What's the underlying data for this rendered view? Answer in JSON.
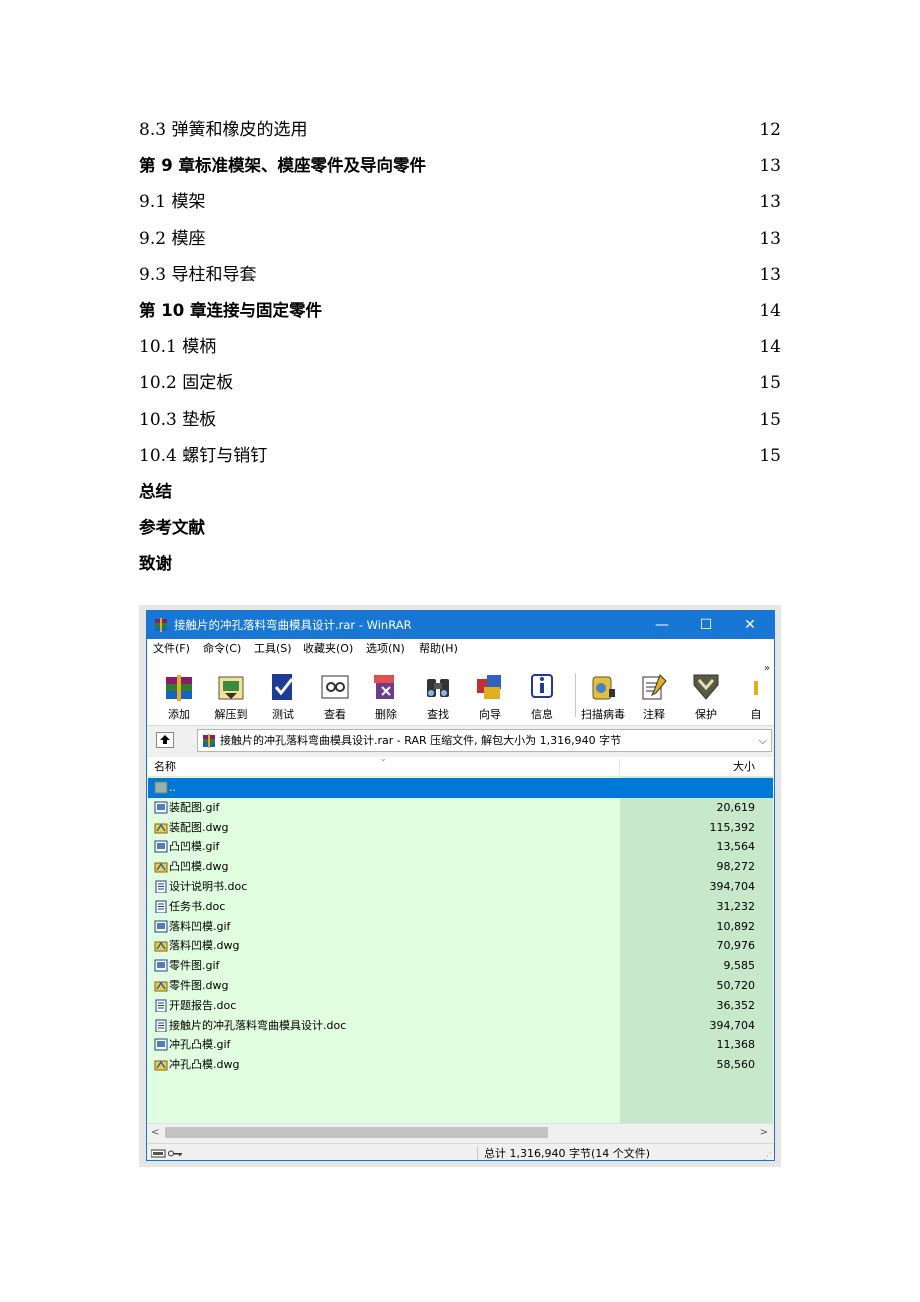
{
  "toc": [
    {
      "title": "8.3 弹簧和橡皮的选用",
      "page": "12",
      "bold": false
    },
    {
      "title": "第 9 章标准模架、模座零件及导向零件",
      "page": "13",
      "bold": true
    },
    {
      "title": "9.1 模架",
      "page": "13",
      "bold": false
    },
    {
      "title": "9.2 模座",
      "page": "13",
      "bold": false
    },
    {
      "title": "9.3 导柱和导套",
      "page": "13",
      "bold": false
    },
    {
      "title": "第 10 章连接与固定零件",
      "page": "14",
      "bold": true
    },
    {
      "title": "10.1 模柄",
      "page": "14",
      "bold": false
    },
    {
      "title": "10.2 固定板",
      "page": "15",
      "bold": false
    },
    {
      "title": "10.3 垫板",
      "page": "15",
      "bold": false
    },
    {
      "title": "10.4 螺钉与销钉",
      "page": "15",
      "bold": false
    },
    {
      "title": "总结",
      "page": "",
      "bold": true
    },
    {
      "title": "参考文献",
      "page": "",
      "bold": true
    },
    {
      "title": "致谢",
      "page": "",
      "bold": true
    }
  ],
  "window": {
    "title": "接触片的冲孔落料弯曲模具设计.rar - WinRAR",
    "controls": {
      "minimize": "—",
      "maximize": "☐",
      "close": "✕"
    },
    "menu": [
      "文件(F)",
      "命令(C)",
      "工具(S)",
      "收藏夹(O)",
      "选项(N)",
      "帮助(H)"
    ],
    "toolbar": [
      {
        "label": "添加",
        "icon": "add-archive-icon"
      },
      {
        "label": "解压到",
        "icon": "extract-to-icon"
      },
      {
        "label": "测试",
        "icon": "test-icon"
      },
      {
        "label": "查看",
        "icon": "view-icon"
      },
      {
        "label": "删除",
        "icon": "delete-icon"
      },
      {
        "label": "查找",
        "icon": "find-icon"
      },
      {
        "label": "向导",
        "icon": "wizard-icon"
      },
      {
        "label": "信息",
        "icon": "info-icon"
      },
      {
        "label": "扫描病毒",
        "icon": "virus-scan-icon"
      },
      {
        "label": "注释",
        "icon": "comment-icon"
      },
      {
        "label": "保护",
        "icon": "protect-icon"
      },
      {
        "label": "自",
        "icon": "sfx-icon"
      }
    ],
    "toolbar_more": "»",
    "address": "接触片的冲孔落料弯曲模具设计.rar - RAR 压缩文件, 解包大小为 1,316,940 字节",
    "address_dropdown": "⌵",
    "columns": {
      "name": "名称",
      "size": "大小",
      "sort_mark": "⌄"
    },
    "files": [
      {
        "name": "..",
        "size": "",
        "type": "folder-up",
        "selected": true
      },
      {
        "name": "装配图.gif",
        "size": "20,619",
        "type": "gif"
      },
      {
        "name": "装配图.dwg",
        "size": "115,392",
        "type": "dwg"
      },
      {
        "name": "凸凹模.gif",
        "size": "13,564",
        "type": "gif"
      },
      {
        "name": "凸凹模.dwg",
        "size": "98,272",
        "type": "dwg"
      },
      {
        "name": "设计说明书.doc",
        "size": "394,704",
        "type": "doc"
      },
      {
        "name": "任务书.doc",
        "size": "31,232",
        "type": "doc"
      },
      {
        "name": "落料凹模.gif",
        "size": "10,892",
        "type": "gif"
      },
      {
        "name": "落料凹模.dwg",
        "size": "70,976",
        "type": "dwg"
      },
      {
        "name": "零件图.gif",
        "size": "9,585",
        "type": "gif"
      },
      {
        "name": "零件图.dwg",
        "size": "50,720",
        "type": "dwg"
      },
      {
        "name": "开题报告.doc",
        "size": "36,352",
        "type": "doc"
      },
      {
        "name": "接触片的冲孔落料弯曲模具设计.doc",
        "size": "394,704",
        "type": "doc"
      },
      {
        "name": "冲孔凸模.gif",
        "size": "11,368",
        "type": "gif"
      },
      {
        "name": "冲孔凸模.dwg",
        "size": "58,560",
        "type": "dwg"
      }
    ],
    "scroll": {
      "left": "<",
      "right": ">"
    },
    "status": "总计 1,316,940 字节(14 个文件)",
    "grip": "⋰"
  },
  "colors": {
    "title_bar": "#1877d4",
    "list_bg": "#e0fde0",
    "size_col_bg": "#c8e8cc",
    "selection": "#0078d7"
  }
}
